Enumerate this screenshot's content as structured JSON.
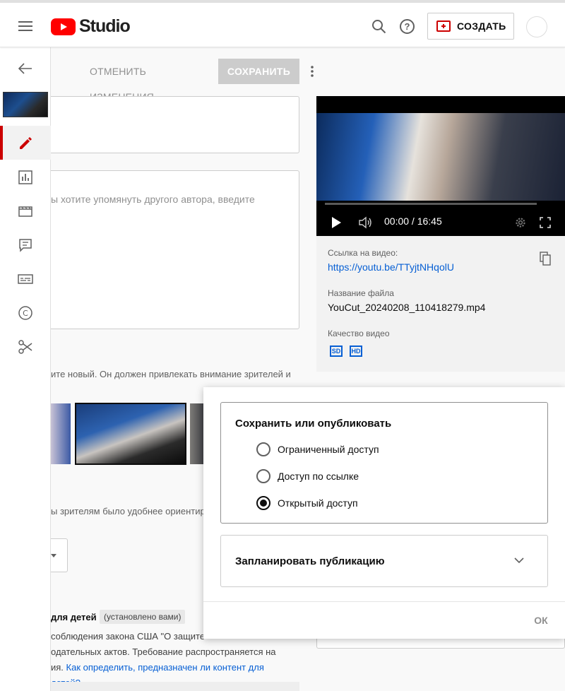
{
  "header": {
    "logo_text": "Studio",
    "create_label": "СОЗДАТЬ",
    "help_glyph": "?"
  },
  "toolbar": {
    "discard_label": "ОТМЕНИТЬ ИЗМЕНЕНИЯ",
    "save_label": "СОХРАНИТЬ"
  },
  "sidebar": {
    "items": [
      "edit-icon",
      "analytics-icon",
      "editor-icon",
      "comments-icon",
      "subtitles-icon",
      "copyright-icon",
      "clips-icon"
    ],
    "copyright_glyph": "C"
  },
  "details": {
    "description_placeholder": "ы хотите упомянуть другого автора, введите",
    "thumbnail_hint": "ите новый. Он должен привлекать внимание зрителей и",
    "playlist_hint": "ы зрителям было удобнее ориентир",
    "kids_title": "для детей",
    "kids_badge": "(установлено вами)",
    "kids_text_1": "соблюдения закона США \"О защите",
    "kids_text_2": "одательных актов. Требование распространяется на",
    "kids_text_3": "ия. ",
    "kids_link": "Как определить, предназначен ли контент для детей?"
  },
  "player": {
    "time": "00:00 / 16:45",
    "progress": 0
  },
  "video_info": {
    "link_label": "Ссылка на видео:",
    "link_value": "https://youtu.be/TTyjtNHqolU",
    "filename_label": "Название файла",
    "filename_value": "YouCut_20240208_110418279.mp4",
    "quality_label": "Качество видео",
    "quality_sd": "SD",
    "quality_hd": "HD"
  },
  "visibility_popup": {
    "title": "Сохранить или опубликовать",
    "options": [
      "Ограниченный доступ",
      "Доступ по ссылке",
      "Открытый доступ"
    ],
    "selected_index": 2,
    "schedule_label": "Запланировать публикацию",
    "ok_label": "ОК"
  },
  "colors": {
    "brand_red": "#ff0000",
    "accent_red": "#cc0000",
    "link_blue": "#065fd4"
  }
}
